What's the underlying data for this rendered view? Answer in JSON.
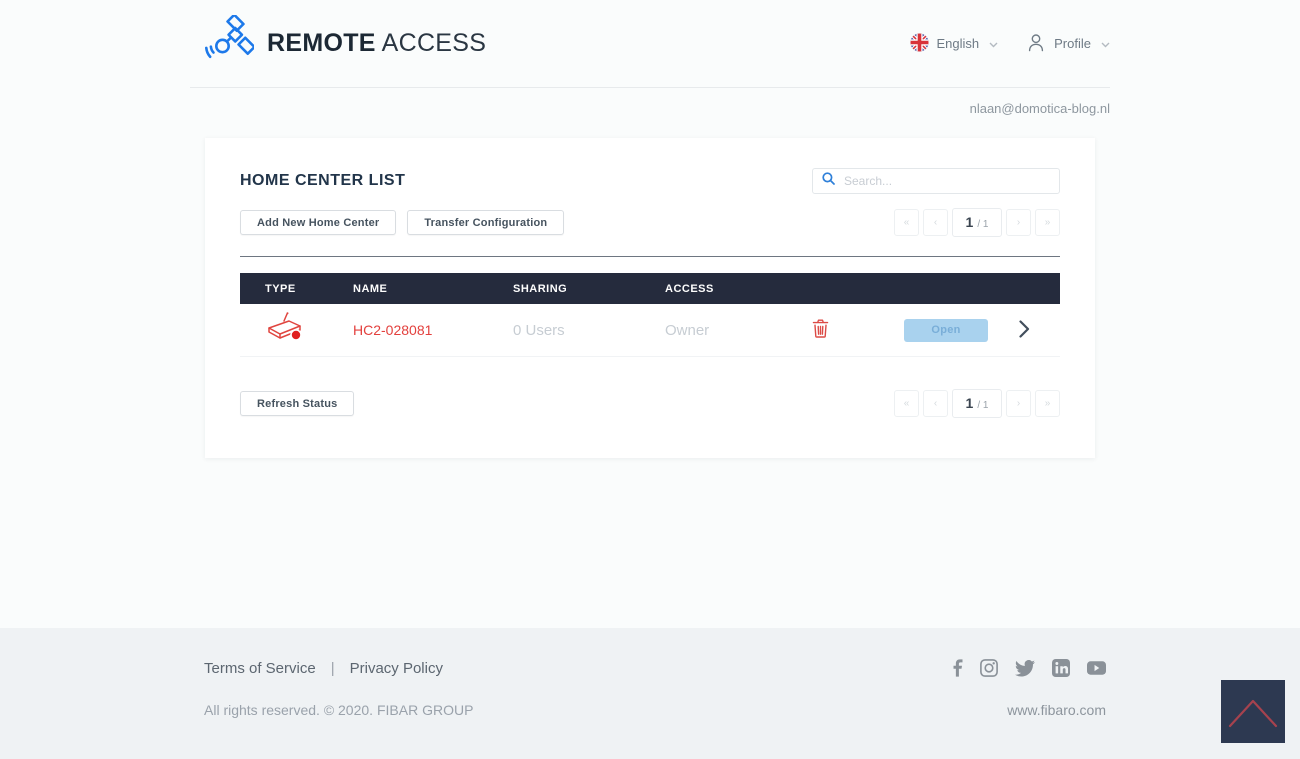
{
  "header": {
    "brand": {
      "bold": "REMOTE",
      "light": "ACCESS"
    },
    "language": {
      "label": "English"
    },
    "profile": {
      "label": "Profile"
    },
    "user_email": "nlaan@domotica-blog.nl"
  },
  "main": {
    "title": "HOME CENTER LIST",
    "search": {
      "placeholder": "Search..."
    },
    "buttons": {
      "add": "Add New Home Center",
      "transfer": "Transfer Configuration",
      "refresh": "Refresh Status"
    },
    "pagination": {
      "first": "«",
      "prev": "‹",
      "current": "1",
      "of": "/ 1",
      "next": "›",
      "last": "»"
    },
    "table": {
      "columns": [
        "TYPE",
        "NAME",
        "SHARING",
        "ACCESS"
      ],
      "rows": [
        {
          "type_icon": "hc2-device-icon",
          "name": "HC2-028081",
          "sharing": "0 Users",
          "access": "Owner",
          "open_label": "Open"
        }
      ]
    }
  },
  "footer": {
    "links": [
      "Terms of Service",
      "Privacy Policy"
    ],
    "separator": "|",
    "copyright": "All rights reserved. © 2020. FIBAR GROUP",
    "website": "www.fibaro.com",
    "social_icons": [
      "facebook",
      "instagram",
      "twitter",
      "linkedin",
      "youtube"
    ]
  },
  "colors": {
    "accent_blue": "#1d79ea",
    "table_header_dark": "#252b3d",
    "alert_red": "#e0403d",
    "open_button_blue": "#a9d2ee",
    "footer_logo_navy": "#2d3951",
    "footer_background": "#eff2f4"
  }
}
